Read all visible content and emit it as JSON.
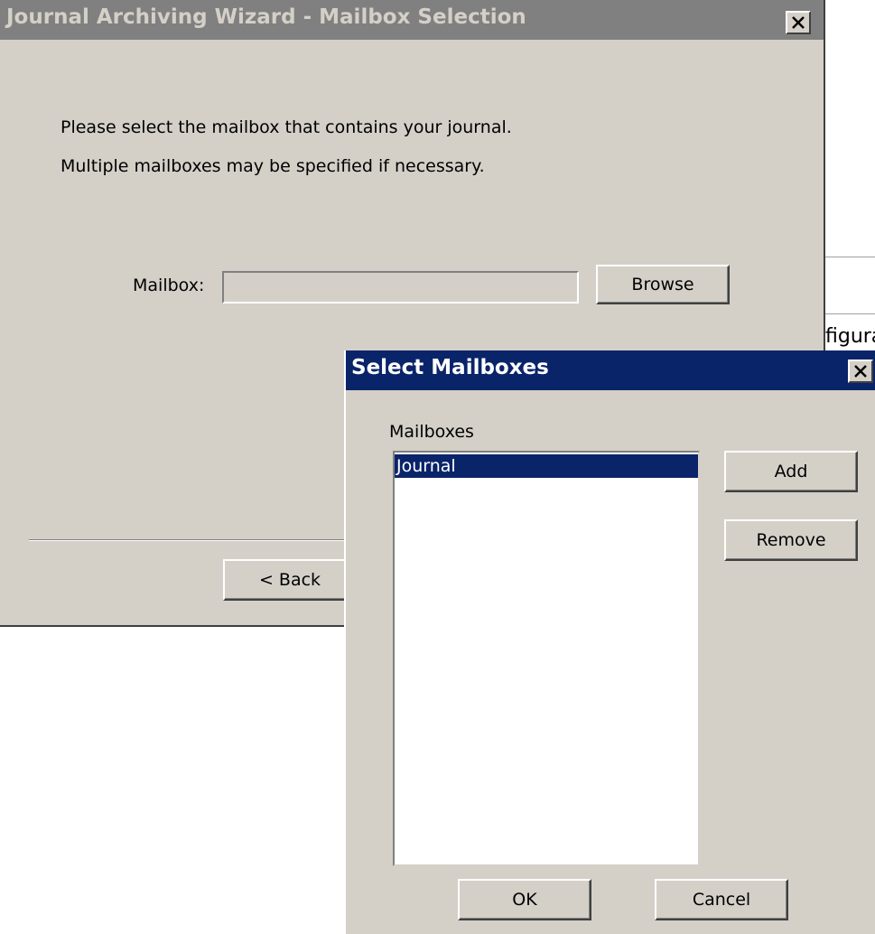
{
  "background": {
    "fragment_text": "figura"
  },
  "wizard": {
    "title": "Journal Archiving Wizard - Mailbox Selection",
    "line1": "Please select the mailbox that contains your journal.",
    "line2": "Multiple mailboxes may be specified if necessary.",
    "mailbox_label": "Mailbox:",
    "mailbox_value": "",
    "browse_label": "Browse",
    "back_label": "< Back"
  },
  "dialog": {
    "title": "Select Mailboxes",
    "group_label": "Mailboxes",
    "items": [
      {
        "label": "Journal",
        "selected": true
      }
    ],
    "add_label": "Add",
    "remove_label": "Remove",
    "ok_label": "OK",
    "cancel_label": "Cancel"
  },
  "colors": {
    "face": "#d4d0c8",
    "active_title": "#0a246a",
    "inactive_title": "#808080"
  }
}
